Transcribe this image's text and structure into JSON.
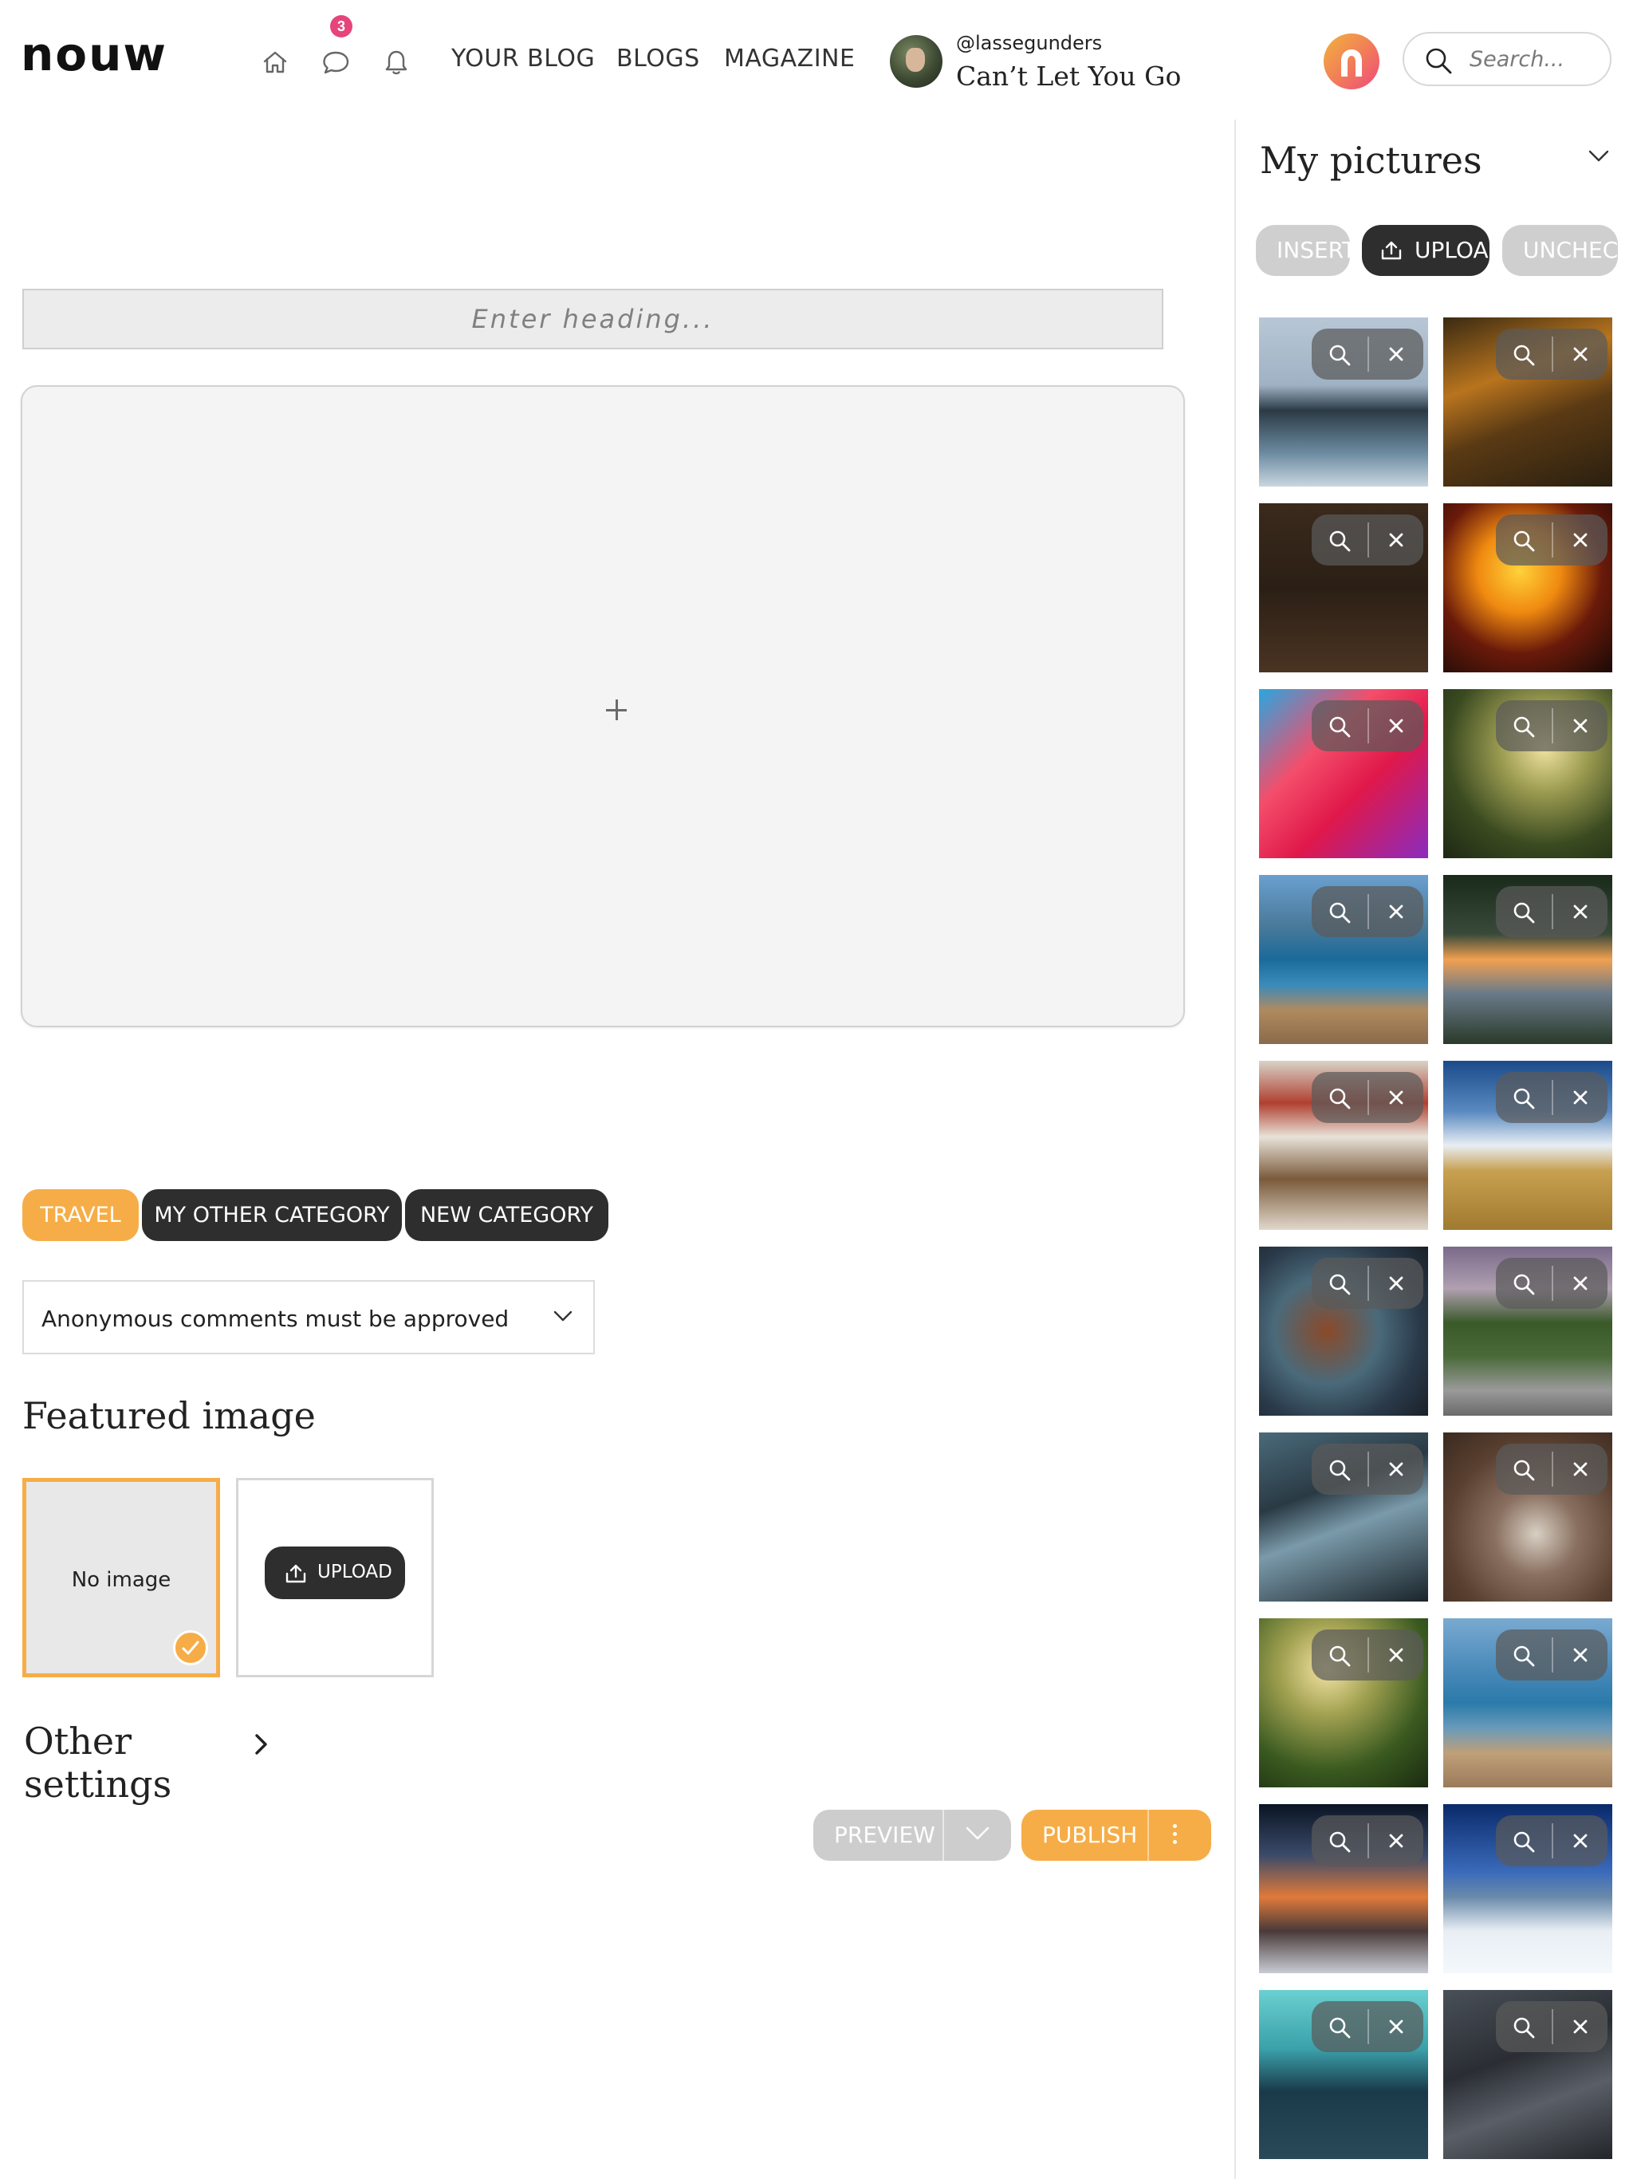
{
  "header": {
    "logo": "nouw",
    "nav_icons": [
      "home-icon",
      "comment-icon",
      "bell-icon"
    ],
    "notification_count": "3",
    "nav_links": [
      "YOUR BLOG",
      "BLOGS",
      "MAGAZINE"
    ],
    "profile": {
      "username": "@lassegunders",
      "blog_name": "Can’t Let You Go"
    },
    "search_placeholder": "Search..."
  },
  "editor": {
    "heading_placeholder": "Enter heading...",
    "add_block": "+",
    "categories": [
      {
        "label": "TRAVEL",
        "active": true
      },
      {
        "label": "MY OTHER CATEGORY",
        "active": false
      },
      {
        "label": "NEW CATEGORY",
        "active": false
      }
    ],
    "comments_setting": "Anonymous comments must be approved",
    "featured_image_title": "Featured image",
    "no_image_label": "No image",
    "upload_label": "UPLOAD",
    "other_settings": "Other settings",
    "preview_label": "PREVIEW",
    "publish_label": "PUBLISH"
  },
  "sidebar": {
    "title": "My pictures",
    "buttons": {
      "insert": "INSERT",
      "upload": "UPLOAD",
      "uncheck": "UNCHECK"
    },
    "pictures": [
      "sea-stacks",
      "autumn-watermill",
      "chicken-menu-board",
      "fire-breather",
      "red-pink-abstract",
      "sunlit-forest",
      "coastal-beach",
      "sunset-coast-trees",
      "art-studio-shelves",
      "wheat-field-sky",
      "rusty-penny-1972",
      "grass-gravel-dusk",
      "cracked-blue-paint",
      "pebbles-ground",
      "forest-sunbeams",
      "beach-cliffs",
      "mountain-sunset",
      "snowy-mountains",
      "teal-bridge",
      "dark-rock-surface"
    ],
    "colors": {
      "accent": "#f6ad48",
      "dark": "#2e2e2e",
      "badge": "#e5457a"
    }
  }
}
